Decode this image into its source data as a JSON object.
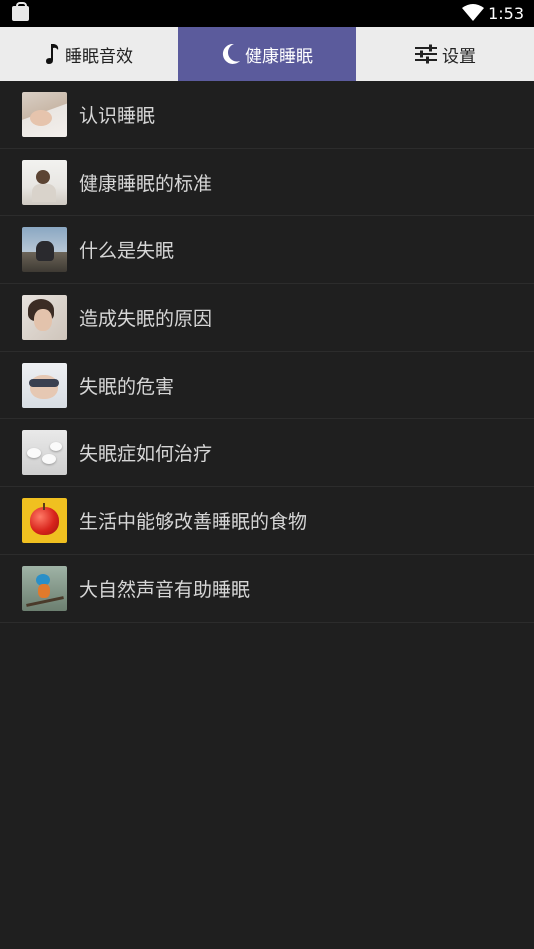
{
  "status_bar": {
    "time": "1:53",
    "icons": [
      "shopping-bag-icon",
      "wifi-icon",
      "battery-icon"
    ]
  },
  "tabs": [
    {
      "label": "睡眠音效",
      "icon": "music-note-icon",
      "active": false
    },
    {
      "label": "健康睡眠",
      "icon": "crescent-moon-icon",
      "active": true
    },
    {
      "label": "设置",
      "icon": "sliders-icon",
      "active": false
    }
  ],
  "colors": {
    "active_tab": "#5b5b9c",
    "tab_background": "#ececec",
    "list_background": "#1f1f1f",
    "list_text": "#d6d6d6"
  },
  "articles": [
    {
      "title": "认识睡眠",
      "thumbnail": "sleeping-baby-image"
    },
    {
      "title": "健康睡眠的标准",
      "thumbnail": "woman-stretching-image"
    },
    {
      "title": "什么是失眠",
      "thumbnail": "person-head-down-image"
    },
    {
      "title": "造成失眠的原因",
      "thumbnail": "woman-headache-image"
    },
    {
      "title": "失眠的危害",
      "thumbnail": "sleep-mask-image"
    },
    {
      "title": "失眠症如何治疗",
      "thumbnail": "pills-image"
    },
    {
      "title": "生活中能够改善睡眠的食物",
      "thumbnail": "apple-image"
    },
    {
      "title": "大自然声音有助睡眠",
      "thumbnail": "kingfisher-bird-image"
    }
  ]
}
